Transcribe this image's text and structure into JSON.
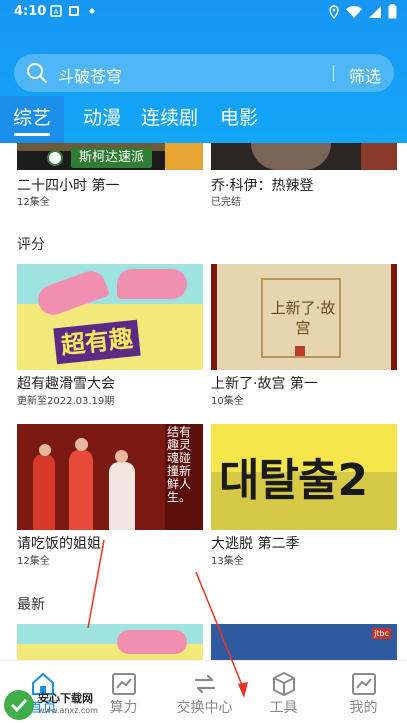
{
  "status": {
    "time": "4:10"
  },
  "search": {
    "query": "斗破苍穹",
    "filter_label": "筛选"
  },
  "tabs": [
    {
      "label": "综艺"
    },
    {
      "label": "动漫"
    },
    {
      "label": "连续剧"
    },
    {
      "label": "电影"
    }
  ],
  "top_row": [
    {
      "title": "二十四小时 第一",
      "sub": "12集全",
      "banner_text": "斯柯达速派"
    },
    {
      "title": "乔·科伊：热辣登",
      "sub": "已完结"
    }
  ],
  "rating_section": {
    "label": "评分",
    "items": [
      {
        "title": "超有趣滑雪大会",
        "sub": "更新至2022.03.19期",
        "poster_text": "超有趣"
      },
      {
        "title": "上新了·故宫 第一",
        "sub": "10集全",
        "poster_text": "上新了·故宫"
      },
      {
        "title": "请吃饭的姐姐",
        "sub": "12集全",
        "poster_text": "结有趣灵魂碰撞新鲜人生。"
      },
      {
        "title": "大逃脱 第二季",
        "sub": "13集全",
        "poster_text": "대탈출2"
      }
    ]
  },
  "latest_section": {
    "label": "最新",
    "badge": "jtbc"
  },
  "bottom_nav": [
    {
      "label": "首页",
      "icon": "home-icon"
    },
    {
      "label": "算力",
      "icon": "chart-icon"
    },
    {
      "label": "交换中心",
      "icon": "exchange-icon"
    },
    {
      "label": "工具",
      "icon": "cube-icon"
    },
    {
      "label": "我的",
      "icon": "chart-icon"
    }
  ],
  "watermark": {
    "text": "安心下载网",
    "sub": "www.anxz.com"
  },
  "colors": {
    "primary": "#1796f3",
    "active_tab": "#1a8ee8",
    "poster_yellow": "#f4e64a"
  }
}
